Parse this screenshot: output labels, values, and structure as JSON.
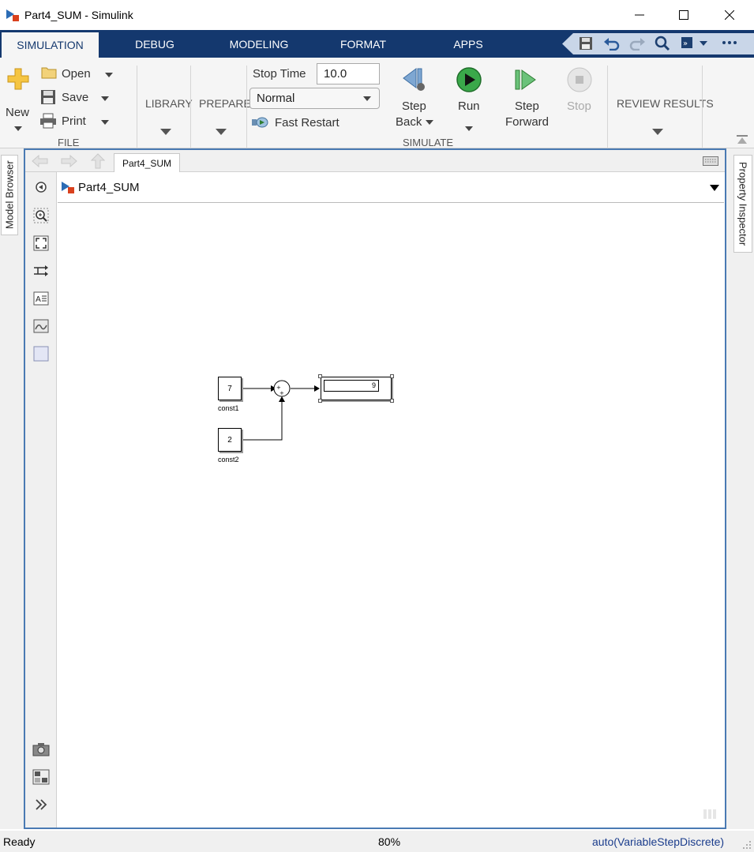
{
  "window": {
    "title": "Part4_SUM - Simulink"
  },
  "tabs": [
    {
      "label": "SIMULATION",
      "active": true
    },
    {
      "label": "DEBUG"
    },
    {
      "label": "MODELING"
    },
    {
      "label": "FORMAT"
    },
    {
      "label": "APPS"
    }
  ],
  "ribbon": {
    "file": {
      "new_label": "New",
      "open_label": "Open",
      "save_label": "Save",
      "print_label": "Print",
      "section_label": "FILE"
    },
    "library_label": "LIBRARY",
    "prepare_label": "PREPARE",
    "simulate": {
      "stop_time_label": "Stop Time",
      "stop_time_value": "10.0",
      "mode_value": "Normal",
      "fast_restart_label": "Fast Restart",
      "step_back_line1": "Step",
      "step_back_line2": "Back",
      "run_label": "Run",
      "step_forward_line1": "Step",
      "step_forward_line2": "Forward",
      "stop_label": "Stop",
      "section_label": "SIMULATE"
    },
    "review_results_label": "REVIEW RESULTS"
  },
  "side_panels": {
    "left_label": "Model Browser",
    "right_label": "Property Inspector"
  },
  "editor": {
    "tab_label": "Part4_SUM",
    "breadcrumb": "Part4_SUM"
  },
  "model": {
    "const1": {
      "value": "7",
      "label": "const1"
    },
    "const2": {
      "value": "2",
      "label": "const2"
    },
    "sum_signs": "++",
    "display_value": "9"
  },
  "status": {
    "left": "Ready",
    "zoom": "80%",
    "solver": "auto(VariableStepDiscrete)"
  },
  "colors": {
    "tab_bar": "#14386e",
    "editor_border": "#4a7ab3",
    "run_green": "#2e9e3e",
    "solver_text": "#1a3c8c"
  }
}
